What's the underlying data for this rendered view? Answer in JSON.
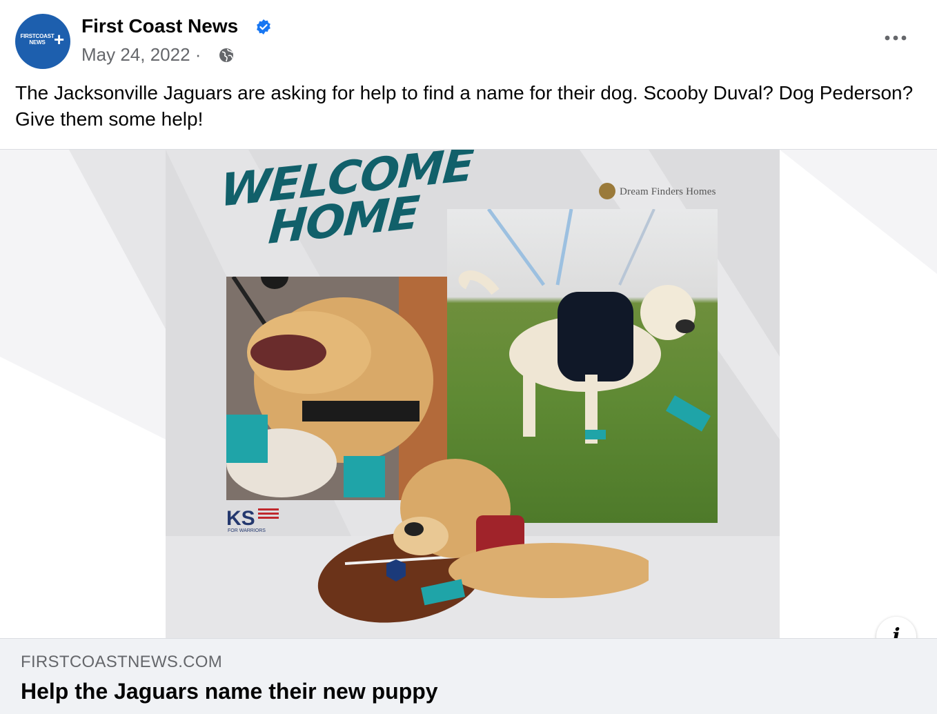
{
  "post": {
    "page_name": "First Coast News",
    "date": "May 24, 2022 ·",
    "text": "The Jacksonville Jaguars are asking for help to find a name for their dog. Scooby Duval? Dog Pederson? Give them some help!",
    "avatar_text": "FIRSTCOAST NEWS"
  },
  "image": {
    "headline": "WELCOME HOME",
    "sponsor": "Dream Finders Homes",
    "partner_logo": "KS",
    "partner_sub": "FOR WARRIORS"
  },
  "link": {
    "domain": "FIRSTCOASTNEWS.COM",
    "title": "Help the Jaguars name their new puppy"
  },
  "icons": {
    "verified": "verified-badge-icon",
    "privacy": "globe-icon",
    "more": "more-options-icon",
    "info": "info-icon"
  },
  "colors": {
    "brand_blue": "#1d5fae",
    "verified_blue": "#1877f2",
    "teal": "#11606a",
    "secondary_text": "#65676b"
  }
}
